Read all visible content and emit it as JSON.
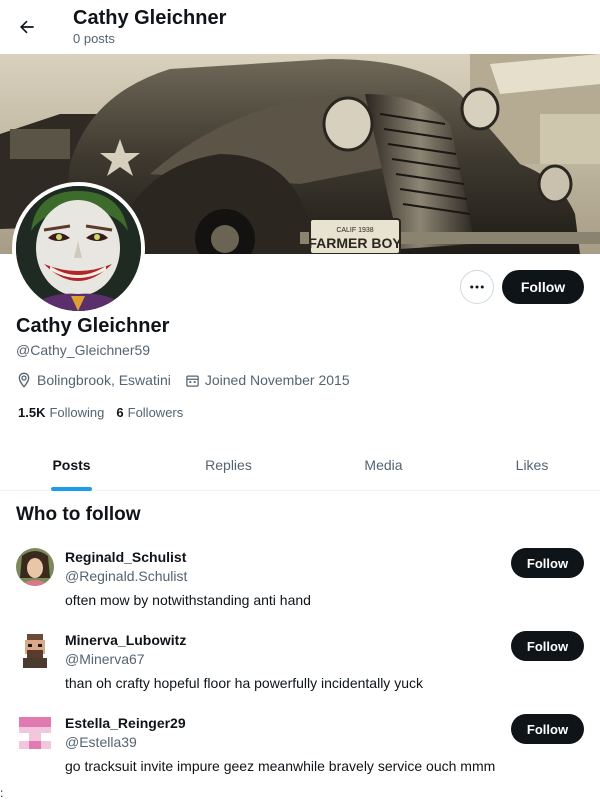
{
  "header": {
    "title": "Cathy Gleichner",
    "subtitle": "0 posts"
  },
  "banner": {
    "plate_text": "FARMER BOY",
    "plate_top": "CALIF 1938"
  },
  "profile": {
    "name": "Cathy Gleichner",
    "handle": "@Cathy_Gleichner59",
    "location": "Bolingbrook, Eswatini",
    "joined": "Joined November 2015",
    "following_count": "1.5K",
    "following_label": "Following",
    "followers_count": "6",
    "followers_label": "Followers",
    "follow_label": "Follow",
    "more_label": "···"
  },
  "tabs": [
    {
      "label": "Posts",
      "active": true
    },
    {
      "label": "Replies",
      "active": false
    },
    {
      "label": "Media",
      "active": false
    },
    {
      "label": "Likes",
      "active": false
    }
  ],
  "who_to_follow": {
    "title": "Who to follow",
    "items": [
      {
        "name": "Reginald_Schulist",
        "handle": "@Reginald.Schulist",
        "bio": "often mow by notwithstanding anti hand",
        "follow_label": "Follow"
      },
      {
        "name": "Minerva_Lubowitz",
        "handle": "@Minerva67",
        "bio": "than oh crafty hopeful floor ha powerfully incidentally yuck",
        "follow_label": "Follow"
      },
      {
        "name": "Estella_Reinger29",
        "handle": "@Estella39",
        "bio": "go tracksuit invite impure geez meanwhile bravely service ouch mmm",
        "follow_label": "Follow"
      }
    ]
  },
  "footer_mark": ":",
  "colors": {
    "accent": "#1d9bf0",
    "text": "#0f1419",
    "muted": "#536471",
    "button_dark": "#0f1419"
  }
}
